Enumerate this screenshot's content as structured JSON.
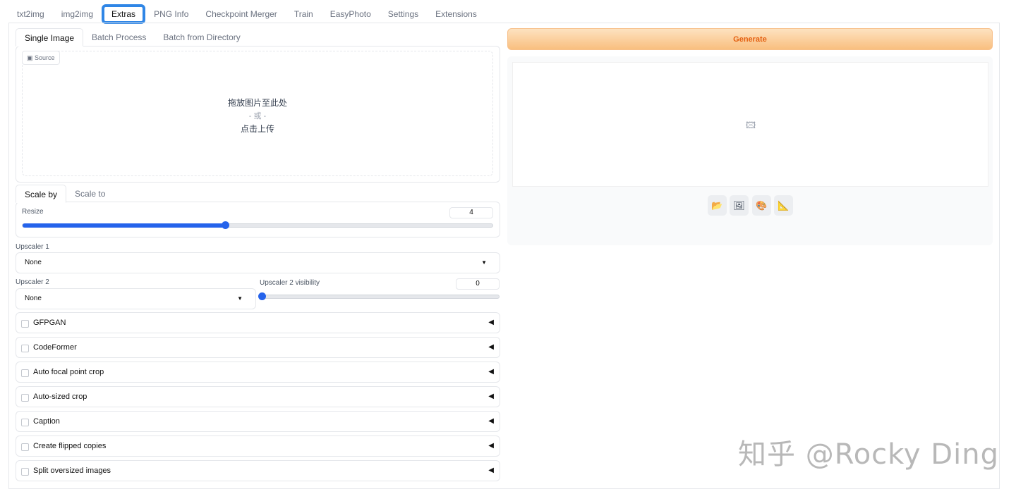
{
  "top_tabs": [
    "txt2img",
    "img2img",
    "Extras",
    "PNG Info",
    "Checkpoint Merger",
    "Train",
    "EasyPhoto",
    "Settings",
    "Extensions"
  ],
  "sub_tabs": [
    "Single Image",
    "Batch Process",
    "Batch from Directory"
  ],
  "source": {
    "badge": "Source",
    "drop_line1": "拖放图片至此处",
    "drop_line2": "- 或 -",
    "drop_line3": "点击上传"
  },
  "scale_tabs": [
    "Scale by",
    "Scale to"
  ],
  "resize": {
    "label": "Resize",
    "value": "4",
    "fraction": 0.43
  },
  "upscaler1": {
    "label": "Upscaler 1",
    "value": "None"
  },
  "upscaler2": {
    "label": "Upscaler 2",
    "value": "None"
  },
  "upscaler2_visibility": {
    "label": "Upscaler 2 visibility",
    "value": "0",
    "fraction": 0
  },
  "accordions": [
    "GFPGAN",
    "CodeFormer",
    "Auto focal point crop",
    "Auto-sized crop",
    "Caption",
    "Create flipped copies",
    "Split oversized images"
  ],
  "generate_label": "Generate",
  "output_tools": [
    "folder-icon",
    "image-icon",
    "palette-icon",
    "triangle-ruler-icon"
  ],
  "watermark": "知乎 @Rocky Ding"
}
